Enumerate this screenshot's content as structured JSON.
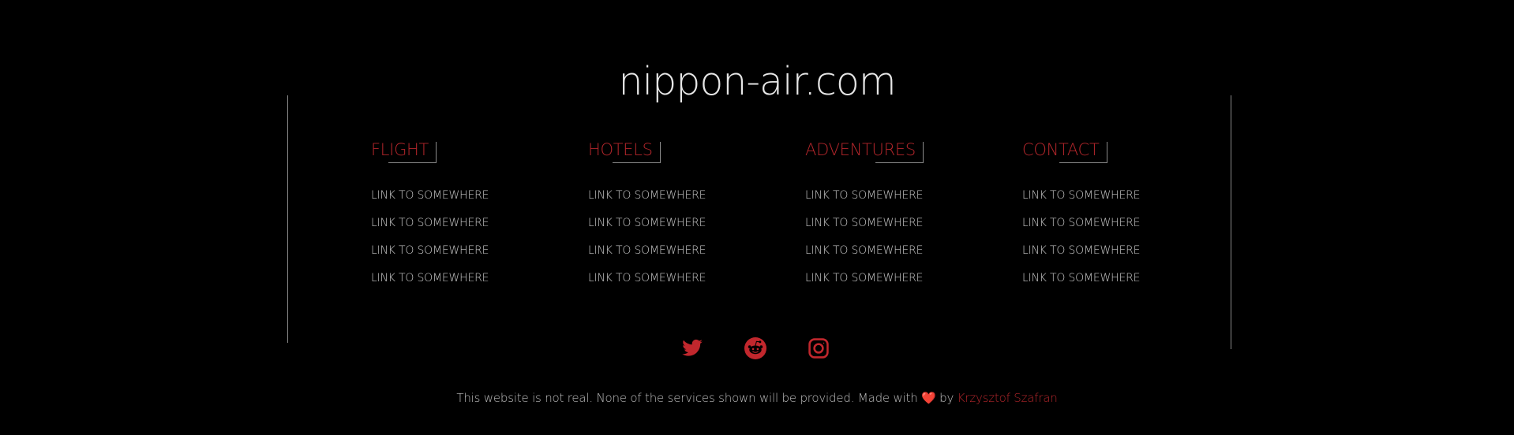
{
  "site": {
    "title": "nippon-air.com"
  },
  "columns": [
    {
      "heading": "FLIGHT",
      "links": [
        "LINK TO SOMEWHERE",
        "LINK TO SOMEWHERE",
        "LINK TO SOMEWHERE",
        "LINK TO SOMEWHERE"
      ]
    },
    {
      "heading": "HOTELS",
      "links": [
        "LINK TO SOMEWHERE",
        "LINK TO SOMEWHERE",
        "LINK TO SOMEWHERE",
        "LINK TO SOMEWHERE"
      ]
    },
    {
      "heading": "ADVENTURES",
      "links": [
        "LINK TO SOMEWHERE",
        "LINK TO SOMEWHERE",
        "LINK TO SOMEWHERE",
        "LINK TO SOMEWHERE"
      ]
    },
    {
      "heading": "CONTACT",
      "links": [
        "LINK TO SOMEWHERE",
        "LINK TO SOMEWHERE",
        "LINK TO SOMEWHERE",
        "LINK TO SOMEWHERE"
      ]
    }
  ],
  "socials": [
    {
      "icon": "twitter-icon"
    },
    {
      "icon": "reddit-icon"
    },
    {
      "icon": "instagram-icon"
    }
  ],
  "footer": {
    "text_before": "This website is not real. None of the services shown will be provided. Made with",
    "heart": "❤️",
    "text_by": "by",
    "author": "Krzysztof Szafran"
  },
  "colors": {
    "background": "#000000",
    "accent": "#b3262b",
    "text": "#c9c9c9",
    "divider": "#8a8a8a"
  }
}
